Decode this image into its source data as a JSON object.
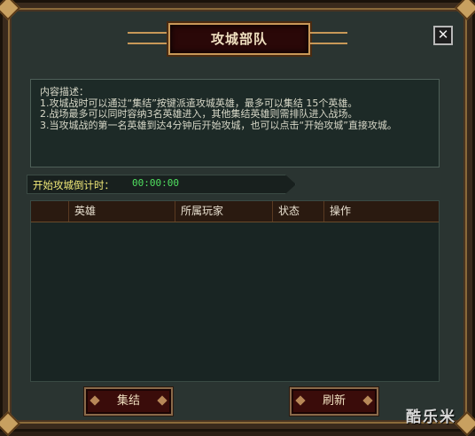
{
  "window": {
    "title": "攻城部队",
    "close_label": "✕"
  },
  "description": {
    "heading": "内容描述：",
    "lines": [
      "1.攻城战时可以通过“集结”按键派遣攻城英雄，最多可以集结 15个英雄。",
      "2.战场最多可以同时容纳3名英雄进入，其他集结英雄则需排队进入战场。",
      "3.当攻城战的第一名英雄到达4分钟后开始攻城，也可以点击“开始攻城”直接攻城。"
    ]
  },
  "countdown": {
    "label": "开始攻城倒计时：",
    "value": "00:00:00"
  },
  "table": {
    "columns": [
      "",
      "英雄",
      "所属玩家",
      "状态",
      "操作"
    ],
    "rows": []
  },
  "buttons": {
    "gather_label": "集结",
    "refresh_label": "刷新"
  },
  "watermark": "酷乐米",
  "colors": {
    "panel_bg": "#2a3431",
    "title_bg": "#2a0808",
    "countdown_label": "#f0e878",
    "countdown_value": "#50e060",
    "button_bg": "#3a0c0a"
  }
}
